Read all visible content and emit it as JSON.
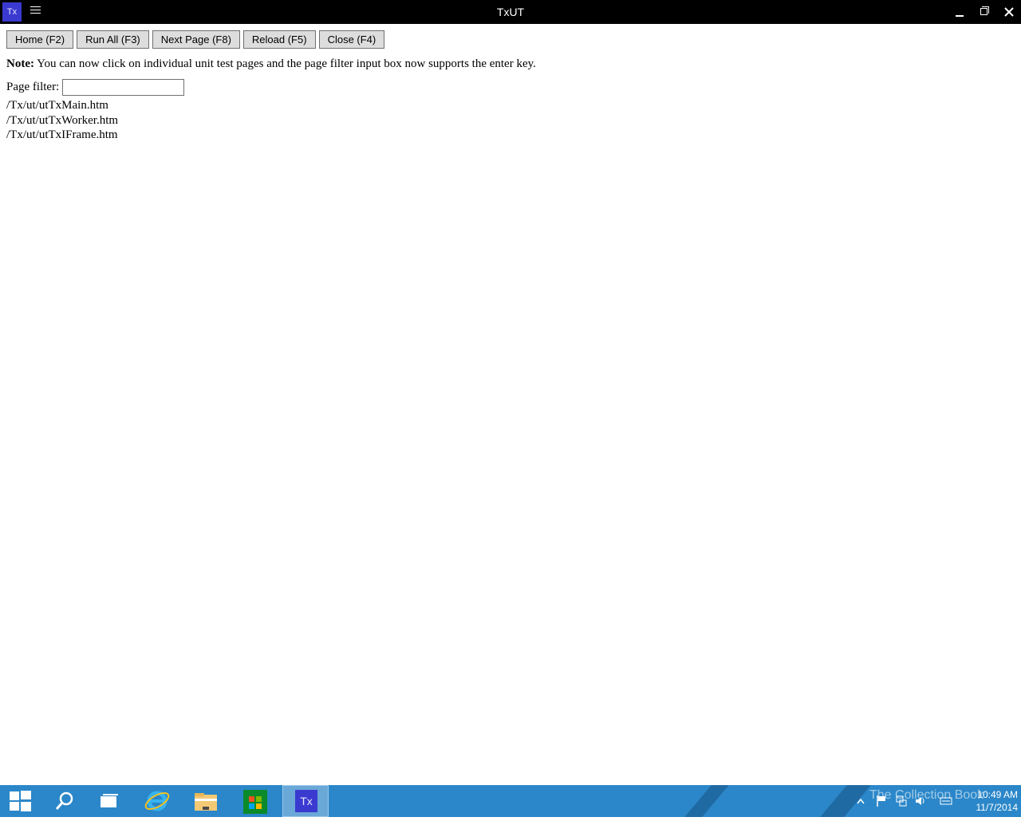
{
  "window": {
    "app_icon_label": "Tx",
    "title": "TxUT"
  },
  "toolbar": {
    "buttons": [
      {
        "label": "Home (F2)"
      },
      {
        "label": "Run All (F3)"
      },
      {
        "label": "Next Page (F8)"
      },
      {
        "label": "Reload (F5)"
      },
      {
        "label": "Close (F4)"
      }
    ]
  },
  "note": {
    "label": "Note:",
    "text": " You can now click on individual unit test pages and the page filter input box now supports the enter key."
  },
  "filter": {
    "label": "Page filter:",
    "value": ""
  },
  "pages": [
    "/Tx/ut/utTxMain.htm",
    "/Tx/ut/utTxWorker.htm",
    "/Tx/ut/utTxIFrame.htm"
  ],
  "taskbar": {
    "active_app_label": "Tx",
    "watermark": "The Collection Book",
    "time": "10:49 AM",
    "date": "11/7/2014",
    "colors": {
      "background": "#2b87c9",
      "app_icon": "#3a3ad0"
    }
  },
  "icons": {
    "start": "windows-logo-icon",
    "search": "search-icon",
    "task_view": "task-view-icon",
    "ie": "internet-explorer-icon",
    "explorer": "file-explorer-icon",
    "store": "store-icon"
  }
}
